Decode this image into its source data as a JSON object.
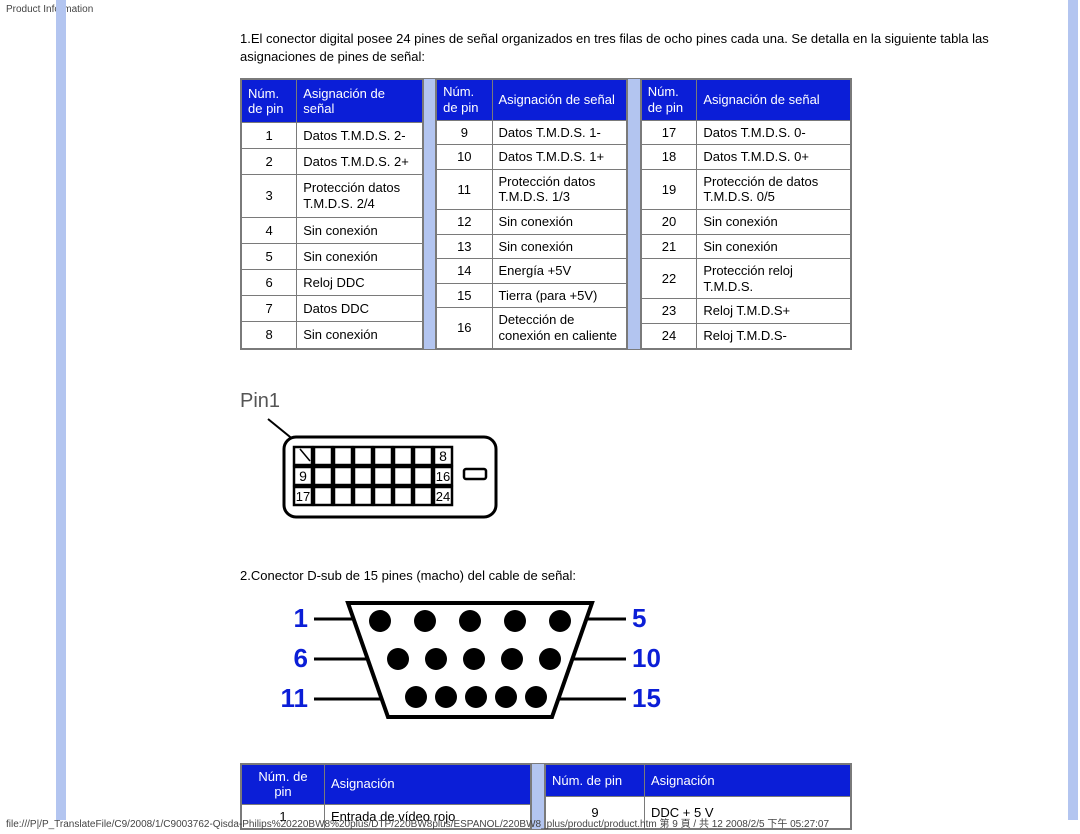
{
  "header": "Product Information",
  "intro": "1.El conector digital posee 24 pines de señal organizados en tres filas de ocho pines cada una. Se detalla en la siguiente tabla las asignaciones de pines de señal:",
  "headers": {
    "pin": "Núm. de pin",
    "assign": "Asignación de señal",
    "pin2": "Núm. de pin",
    "assign2": "Asignación"
  },
  "table1": [
    {
      "n": "1",
      "a": "Datos T.M.D.S. 2-"
    },
    {
      "n": "2",
      "a": "Datos T.M.D.S. 2+"
    },
    {
      "n": "3",
      "a": "Protección datos T.M.D.S. 2/4"
    },
    {
      "n": "4",
      "a": "Sin conexión"
    },
    {
      "n": "5",
      "a": "Sin conexión"
    },
    {
      "n": "6",
      "a": "Reloj DDC"
    },
    {
      "n": "7",
      "a": "Datos DDC"
    },
    {
      "n": "8",
      "a": "Sin conexión"
    }
  ],
  "table2": [
    {
      "n": "9",
      "a": "Datos T.M.D.S. 1-"
    },
    {
      "n": "10",
      "a": "Datos T.M.D.S. 1+"
    },
    {
      "n": "11",
      "a": "Protección datos T.M.D.S. 1/3"
    },
    {
      "n": "12",
      "a": "Sin conexión"
    },
    {
      "n": "13",
      "a": "Sin conexión"
    },
    {
      "n": "14",
      "a": "Energía +5V"
    },
    {
      "n": "15",
      "a": "Tierra (para +5V)"
    },
    {
      "n": "16",
      "a": "Detección de conexión en caliente"
    }
  ],
  "table3": [
    {
      "n": "17",
      "a": "Datos T.M.D.S. 0-"
    },
    {
      "n": "18",
      "a": "Datos T.M.D.S. 0+"
    },
    {
      "n": "19",
      "a": "Protección de datos T.M.D.S. 0/5"
    },
    {
      "n": "20",
      "a": "Sin conexión"
    },
    {
      "n": "21",
      "a": "Sin conexión"
    },
    {
      "n": "22",
      "a": "Protección reloj T.M.D.S."
    },
    {
      "n": "23",
      "a": "Reloj T.M.D.S+"
    },
    {
      "n": "24",
      "a": "Reloj T.M.D.S-"
    }
  ],
  "pin1": "Pin1",
  "dvi_nums": {
    "r1": "8",
    "r2l": "9",
    "r2r": "16",
    "r3l": "17",
    "r3r": "24"
  },
  "para2": "2.Conector D-sub de 15 pines (macho) del cable de señal:",
  "dsub_nums": {
    "l1": "1",
    "l2": "6",
    "l3": "11",
    "r1": "5",
    "r2": "10",
    "r3": "15"
  },
  "table4": [
    {
      "n": "1",
      "a": "Entrada de vídeo rojo"
    }
  ],
  "table5": [
    {
      "n": "9",
      "a": "DDC + 5 V"
    }
  ],
  "footer": "file:///P|/P_TranslateFile/C9/2008/1/C9003762-Qisda-Philips%20220BW8%20plus/DTP/220BW8plus/ESPANOL/220BW8_plus/product/product.htm 第 9 頁 / 共 12 2008/2/5 下午 05:27:07"
}
